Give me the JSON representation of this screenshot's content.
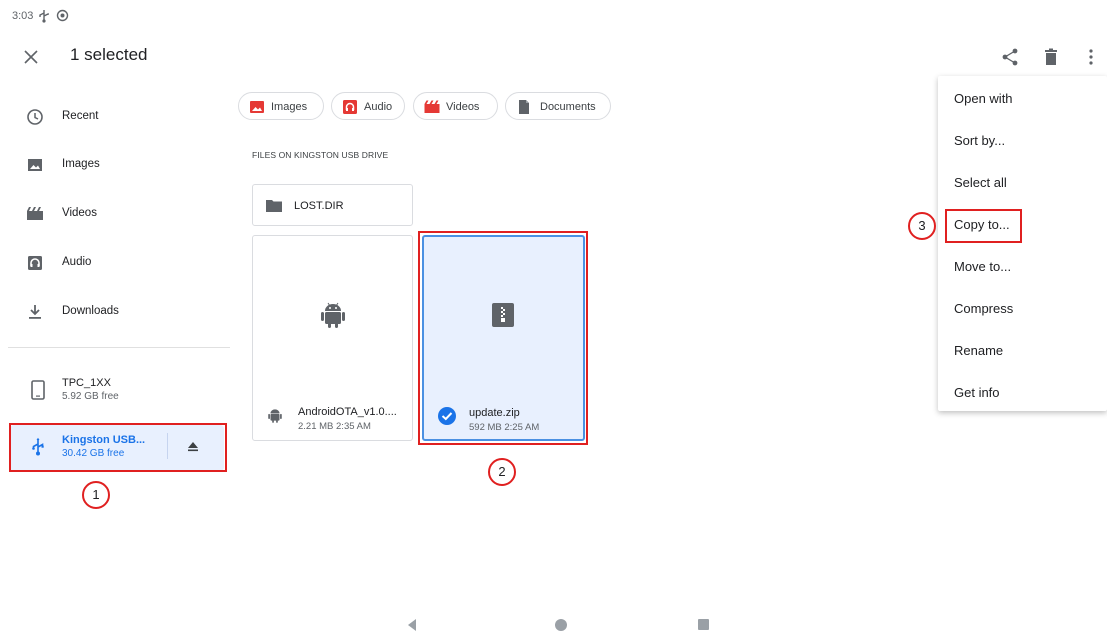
{
  "status_bar": {
    "time": "3:03",
    "icons": [
      "usb-icon",
      "sync-icon"
    ]
  },
  "app_bar": {
    "title": "1 selected",
    "actions": [
      "share-icon",
      "delete-icon",
      "more-vert-icon"
    ]
  },
  "sidebar": {
    "roots": [
      {
        "label": "Recent",
        "icon": "clock-icon"
      },
      {
        "label": "Images",
        "icon": "image-icon"
      },
      {
        "label": "Videos",
        "icon": "video-icon"
      },
      {
        "label": "Audio",
        "icon": "audio-icon"
      },
      {
        "label": "Downloads",
        "icon": "download-icon"
      }
    ],
    "devices": [
      {
        "name": "TPC_1XX",
        "free": "5.92 GB free",
        "icon": "phone-icon"
      },
      {
        "name": "Kingston USB...",
        "free": "30.42 GB free",
        "icon": "usb-icon",
        "selected": true
      }
    ]
  },
  "chips": [
    {
      "label": "Images",
      "icon": "image-icon",
      "color": "#e53935"
    },
    {
      "label": "Audio",
      "icon": "audio-icon",
      "color": "#e53935"
    },
    {
      "label": "Videos",
      "icon": "video-icon",
      "color": "#e53935"
    },
    {
      "label": "Documents",
      "icon": "document-icon",
      "color": "#5f6368"
    }
  ],
  "section_label": "FILES ON KINGSTON USB DRIVE",
  "folder": {
    "name": "LOST.DIR"
  },
  "files": [
    {
      "name": "AndroidOTA_v1.0....",
      "meta": "2.21 MB 2:35 AM",
      "icon": "android-icon",
      "selected": false
    },
    {
      "name": "update.zip",
      "meta": "592 MB 2:25 AM",
      "icon": "zip-icon",
      "selected": true
    }
  ],
  "menu": {
    "items": [
      "Open with",
      "Sort by...",
      "Select all",
      "Copy to...",
      "Move to...",
      "Compress",
      "Rename",
      "Get info"
    ]
  },
  "annotations": [
    "1",
    "2",
    "3"
  ],
  "colors": {
    "accent": "#1a73e8",
    "selected_bg": "#e8f0fe",
    "highlight": "#e02020"
  }
}
